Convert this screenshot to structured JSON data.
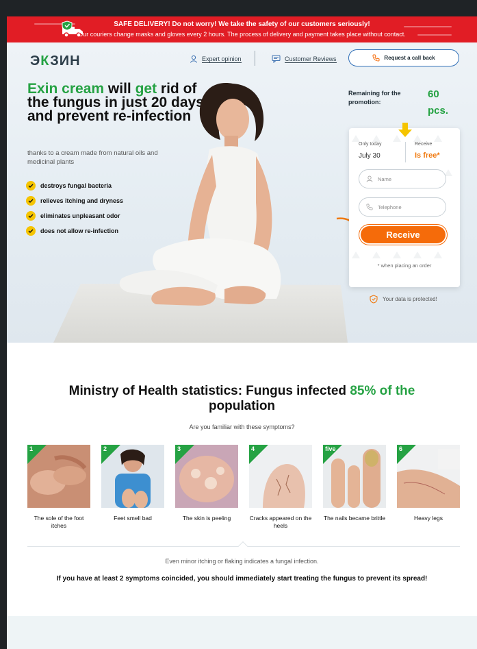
{
  "banner": {
    "title": "SAFE DELIVERY! Do not worry! We take the safety of our customers seriously!",
    "text": "Our couriers change masks and gloves every 2 hours. The process of delivery and payment takes place without contact."
  },
  "header": {
    "logo_a": "Э",
    "logo_b": "К",
    "logo_c": "ЗИН",
    "nav": [
      {
        "label": "Expert opinion",
        "icon": "user-icon"
      },
      {
        "label": "Customer Reviews",
        "icon": "chat-icon"
      }
    ],
    "call_label": "Request a call back"
  },
  "hero": {
    "title_green_1": "Exin cream",
    "title_1": " will ",
    "title_green_2": "get",
    "title_2": " rid of the fungus in just 20 days and prevent re-infection",
    "subtitle": "thanks to a cream made from natural oils and medicinal plants",
    "bullets": [
      "destroys fungal bacteria",
      "relieves itching and dryness",
      "eliminates unpleasant odor",
      "does not allow re-infection"
    ]
  },
  "promo": {
    "remaining_label": "Remaining for the promotion:",
    "count": "60",
    "unit": "pcs."
  },
  "form": {
    "only_today_label": "Only today",
    "date": "July 30",
    "receive_label": "Receive",
    "free_label": "Is free*",
    "name_placeholder": "Name",
    "phone_placeholder": "Telephone",
    "submit_label": "Receive",
    "note": "* when placing an order",
    "protected": "Your data is protected!"
  },
  "stats": {
    "title_1": "Ministry of Health statistics: Fungus infected ",
    "title_green": "85% of the",
    "title_2": "population",
    "subtitle": "Are you familiar with these symptoms?",
    "symptoms": [
      {
        "num": "1",
        "caption": "The sole of the foot itches"
      },
      {
        "num": "2",
        "caption": "Feet smell bad"
      },
      {
        "num": "3",
        "caption": "The skin is peeling"
      },
      {
        "num": "4",
        "caption": "Cracks appeared on the heels"
      },
      {
        "num": "five",
        "caption": "The nails became brittle"
      },
      {
        "num": "6",
        "caption": "Heavy legs"
      }
    ],
    "minor": "Even minor itching or flaking indicates a fungal infection.",
    "advice": "If you have at least 2 symptoms coincided, you should immediately start treating the fungus to prevent its spread!"
  },
  "colors": {
    "accent_green": "#25a243",
    "banner_red": "#e11d25",
    "button_orange": "#f56b0a"
  }
}
